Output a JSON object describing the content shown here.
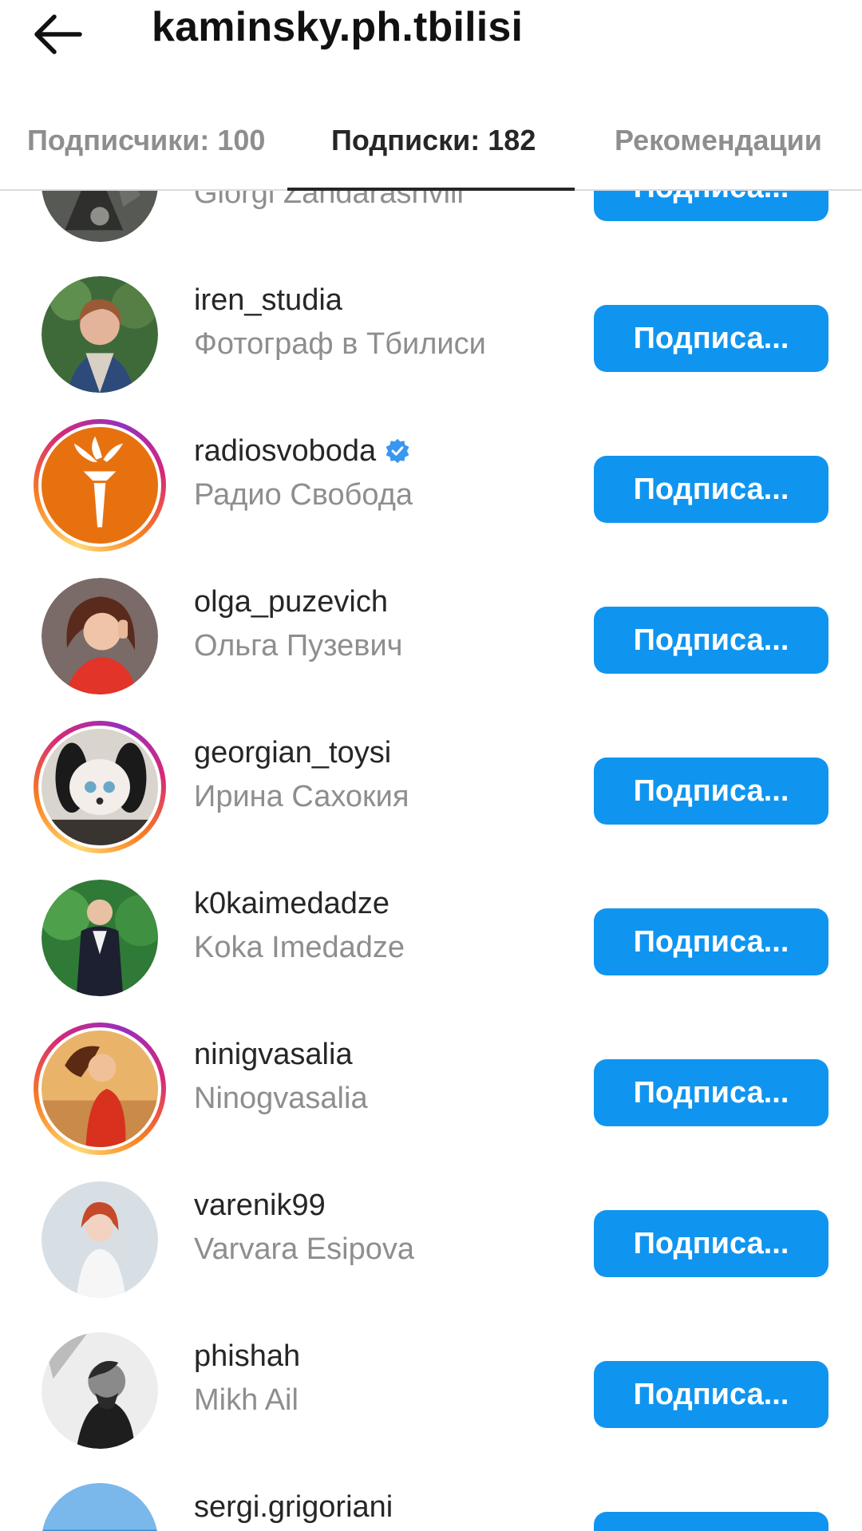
{
  "header": {
    "title": "kaminsky.ph.tbilisi",
    "back_icon": "arrow-left-icon"
  },
  "tabs": [
    {
      "label": "Подписчики: 100",
      "active": false
    },
    {
      "label": "Подписки: 182",
      "active": true
    },
    {
      "label": "Рекомендации",
      "active": false
    }
  ],
  "accounts": [
    {
      "username": "",
      "full_name": "Giorgi Zandarashvili",
      "button": "Подписа...",
      "story_ring": false,
      "verified": false
    },
    {
      "username": "iren_studia",
      "full_name": "Фотограф в Тбилиси",
      "button": "Подписа...",
      "story_ring": false,
      "verified": false
    },
    {
      "username": "radiosvoboda",
      "full_name": "Радио Свобода",
      "button": "Подписа...",
      "story_ring": true,
      "verified": true
    },
    {
      "username": "olga_puzevich",
      "full_name": "Ольга Пузевич",
      "button": "Подписа...",
      "story_ring": false,
      "verified": false
    },
    {
      "username": "georgian_toysi",
      "full_name": "Ирина Сахокия",
      "button": "Подписа...",
      "story_ring": true,
      "verified": false
    },
    {
      "username": "k0kaimedadze",
      "full_name": "Koka Imedadze",
      "button": "Подписа...",
      "story_ring": false,
      "verified": false
    },
    {
      "username": "ninigvasalia",
      "full_name": "Ninogvasalia",
      "button": "Подписа...",
      "story_ring": true,
      "verified": false
    },
    {
      "username": "varenik99",
      "full_name": "Varvara Esipova",
      "button": "Подписа...",
      "story_ring": false,
      "verified": false
    },
    {
      "username": "phishah",
      "full_name": "Mikh Ail",
      "button": "Подписа...",
      "story_ring": false,
      "verified": false
    },
    {
      "username": "sergi.grigoriani",
      "full_name": "",
      "button": "Подписа...",
      "story_ring": false,
      "verified": false
    }
  ],
  "colors": {
    "accent": "#0f95f0",
    "verified": "#3897f0",
    "secondary_text": "#8e8e8e",
    "primary_text": "#262626"
  }
}
